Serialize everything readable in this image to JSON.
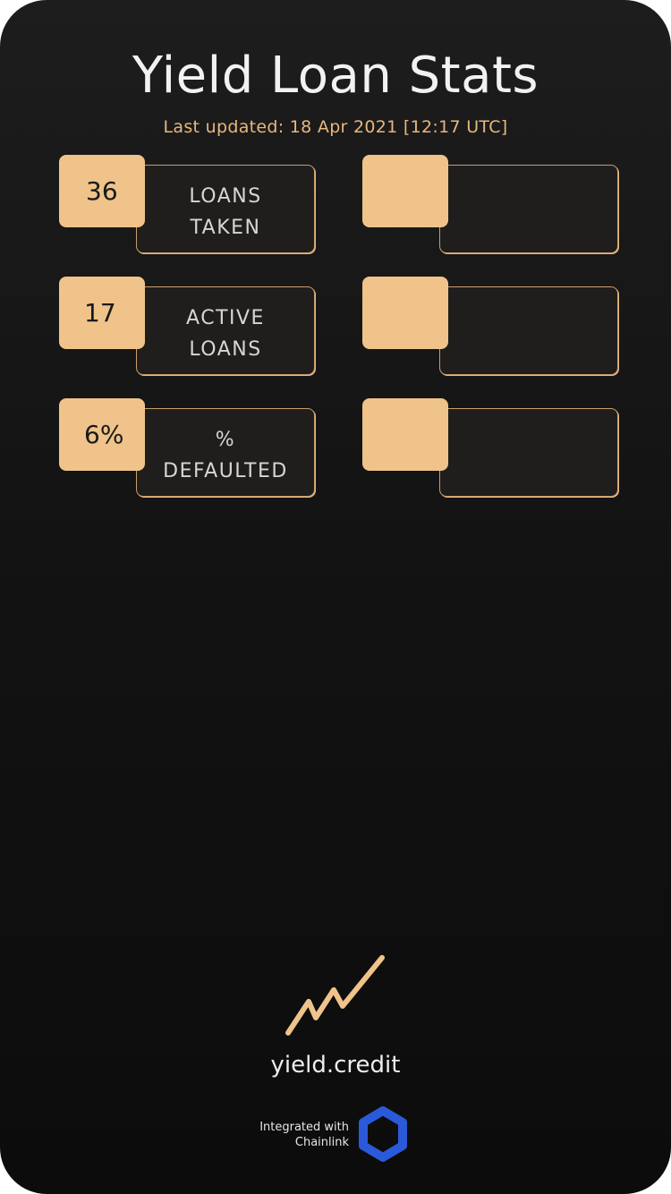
{
  "header": {
    "title": "Yield Loan Stats",
    "last_updated": "Last updated: 18 Apr 2021 [12:17 UTC]"
  },
  "stats_left": [
    {
      "value": "36",
      "label_line1": "LOANS",
      "label_line2": "TAKEN"
    },
    {
      "value": "17",
      "label_line1": "ACTIVE",
      "label_line2": "LOANS"
    },
    {
      "value": "6%",
      "label_line1": "%",
      "label_line2": "DEFAULTED"
    }
  ],
  "stats_right": [
    {
      "value": "",
      "label_line1": "",
      "label_line2": ""
    },
    {
      "value": "",
      "label_line1": "",
      "label_line2": ""
    },
    {
      "value": "",
      "label_line1": "",
      "label_line2": ""
    }
  ],
  "footer": {
    "logo_icon": "zigzag-chart-icon",
    "brand": "yield.credit",
    "integrated_line1": "Integrated with",
    "integrated_line2": "Chainlink",
    "partner_icon": "chainlink-hexagon-icon"
  },
  "colors": {
    "accent": "#efc38a",
    "accent_text": "#e8b77d",
    "card_border": "#c89d6c",
    "background_top": "#1d1d1d",
    "background_bottom": "#0c0c0c",
    "chainlink_blue": "#2a5ada"
  }
}
